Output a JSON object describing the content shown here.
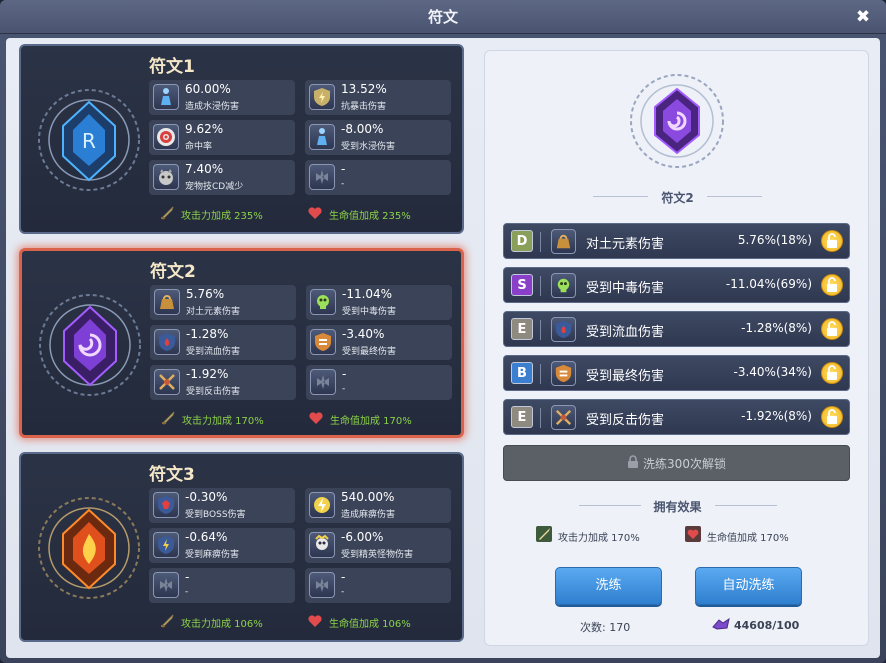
{
  "window": {
    "title": "符文",
    "close_label": "✖"
  },
  "cards": [
    {
      "title": "符文1",
      "theme": "#4db3ff",
      "stats": [
        {
          "value": "60.00%",
          "desc": "造成水浸伤害",
          "icon": "water-figure-icon"
        },
        {
          "value": "13.52%",
          "desc": "抗暴击伤害",
          "icon": "shield-bolt-icon"
        },
        {
          "value": "9.62%",
          "desc": "命中率",
          "icon": "target-icon"
        },
        {
          "value": "-8.00%",
          "desc": "受到水浸伤害",
          "icon": "water-figure-icon"
        },
        {
          "value": "7.40%",
          "desc": "宠物技CD减少",
          "icon": "pet-icon"
        },
        {
          "value": "-",
          "desc": "-",
          "icon": "empty-slot-icon"
        }
      ],
      "atk_bonus": "攻击力加成 235%",
      "hp_bonus": "生命值加成 235%"
    },
    {
      "title": "符文2",
      "theme": "#a35cff",
      "stats": [
        {
          "value": "5.76%",
          "desc": "对土元素伤害",
          "icon": "earth-bag-icon"
        },
        {
          "value": "-11.04%",
          "desc": "受到中毒伤害",
          "icon": "poison-skull-icon"
        },
        {
          "value": "-1.28%",
          "desc": "受到流血伤害",
          "icon": "bleed-shield-icon"
        },
        {
          "value": "-3.40%",
          "desc": "受到最终伤害",
          "icon": "final-shield-icon"
        },
        {
          "value": "-1.92%",
          "desc": "受到反击伤害",
          "icon": "counter-swords-icon"
        },
        {
          "value": "-",
          "desc": "-",
          "icon": "empty-slot-icon"
        }
      ],
      "atk_bonus": "攻击力加成 170%",
      "hp_bonus": "生命值加成 170%"
    },
    {
      "title": "符文3",
      "theme": "#ff8a2a",
      "stats": [
        {
          "value": "-0.30%",
          "desc": "受到BOSS伤害",
          "icon": "boss-shield-icon"
        },
        {
          "value": "540.00%",
          "desc": "造成麻痹伤害",
          "icon": "paralysis-icon"
        },
        {
          "value": "-0.64%",
          "desc": "受到麻痹伤害",
          "icon": "paralysis-shield-icon"
        },
        {
          "value": "-6.00%",
          "desc": "受到精英怪物伤害",
          "icon": "elite-skull-icon"
        },
        {
          "value": "-",
          "desc": "-",
          "icon": "empty-slot-icon"
        },
        {
          "value": "-",
          "desc": "-",
          "icon": "empty-slot-icon"
        }
      ],
      "atk_bonus": "攻击力加成 106%",
      "hp_bonus": "生命值加成 106%"
    }
  ],
  "detail": {
    "title": "符文2",
    "rows": [
      {
        "grade": "D",
        "grade_color": "#8aa05a",
        "name": "对土元素伤害",
        "value": "5.76%(18%)",
        "icon": "earth-bag-icon"
      },
      {
        "grade": "S",
        "grade_color": "#8a3fc9",
        "name": "受到中毒伤害",
        "value": "-11.04%(69%)",
        "icon": "poison-skull-icon"
      },
      {
        "grade": "E",
        "grade_color": "#8e8a80",
        "name": "受到流血伤害",
        "value": "-1.28%(8%)",
        "icon": "bleed-shield-icon"
      },
      {
        "grade": "B",
        "grade_color": "#3a7fd0",
        "name": "受到最终伤害",
        "value": "-3.40%(34%)",
        "icon": "final-shield-icon"
      },
      {
        "grade": "E",
        "grade_color": "#8e8a80",
        "name": "受到反击伤害",
        "value": "-1.92%(8%)",
        "icon": "counter-swords-icon"
      }
    ],
    "unlock_label": "洗练300次解锁",
    "effects_title": "拥有效果",
    "effect_atk": "攻击力加成 170%",
    "effect_hp": "生命值加成 170%",
    "refine_button": "洗练",
    "auto_refine_button": "自动洗练",
    "count_label": "次数: 170",
    "currency": "44608/100"
  }
}
